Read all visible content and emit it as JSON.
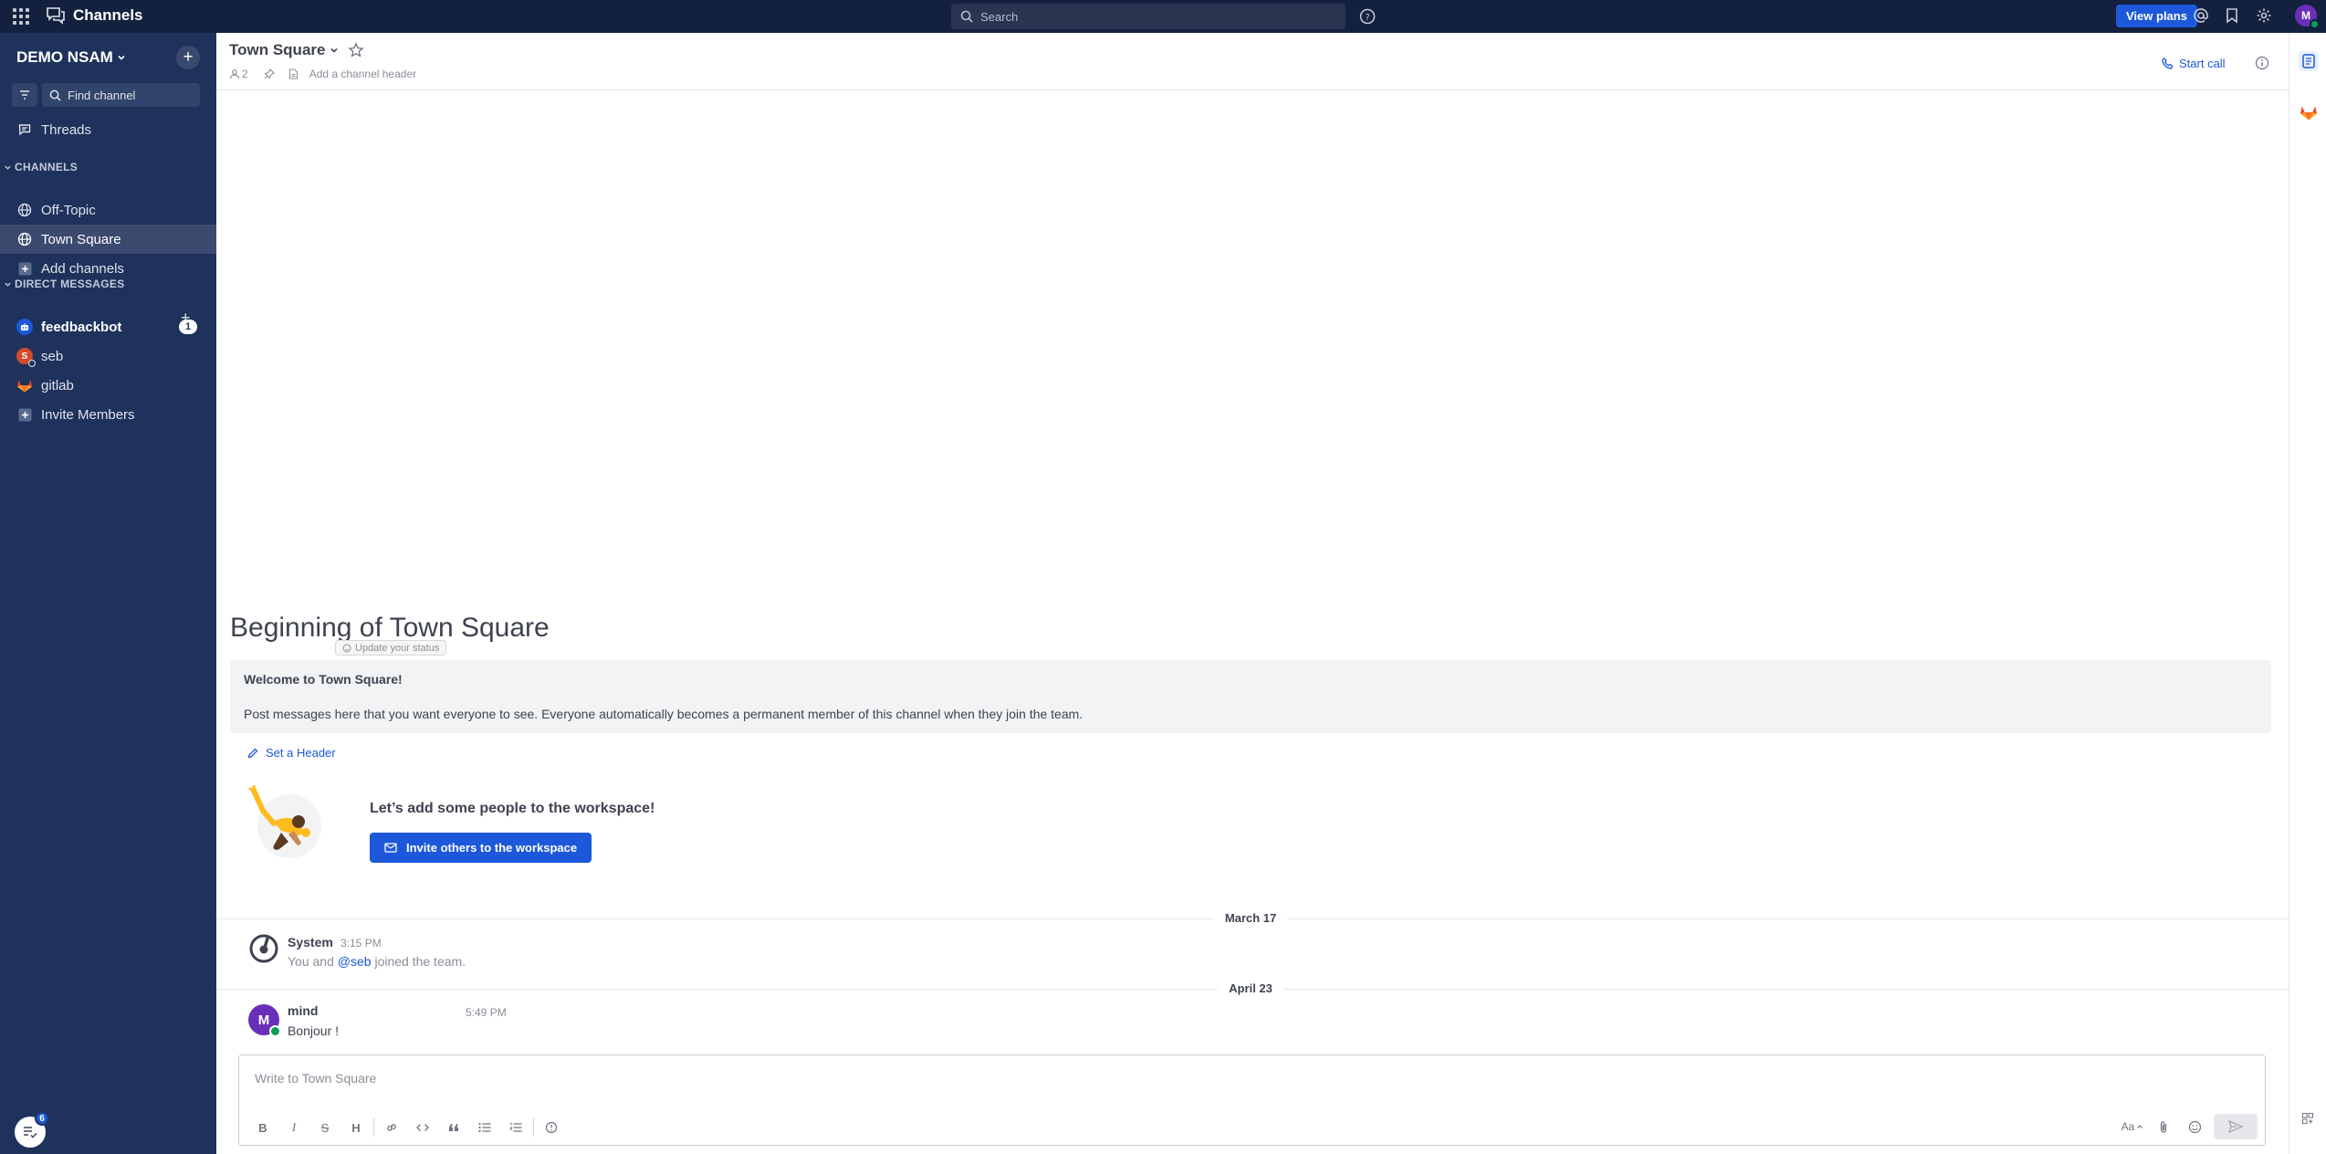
{
  "topbar": {
    "product_name": "Channels",
    "search_placeholder": "Search",
    "view_plans_label": "View plans",
    "avatar_initial": "M"
  },
  "sidebar": {
    "team_name": "DEMO NSAM",
    "find_channel_placeholder": "Find channel",
    "threads_label": "Threads",
    "channels_header": "CHANNELS",
    "channels": [
      {
        "label": "Off-Topic",
        "active": false
      },
      {
        "label": "Town Square",
        "active": true
      }
    ],
    "add_channels_label": "Add channels",
    "dm_header": "DIRECT MESSAGES",
    "dms": [
      {
        "label": "feedbackbot",
        "badge": "1",
        "unread": true
      },
      {
        "label": "seb",
        "avatar_initial": "S"
      },
      {
        "label": "gitlab"
      }
    ],
    "invite_members_label": "Invite Members",
    "bottom_badge": "6"
  },
  "channel": {
    "title": "Town Square",
    "member_count": "2",
    "header_placeholder": "Add a channel header",
    "start_call_label": "Start call"
  },
  "intro": {
    "title": "Beginning of Town Square",
    "welcome_title": "Welcome to Town Square!",
    "welcome_body": "Post messages here that you want everyone to see. Everyone automatically becomes a permanent member of this channel when they join the team.",
    "set_header_label": "Set a Header",
    "invite_title": "Let’s add some people to the workspace!",
    "invite_button": "Invite others to the workspace"
  },
  "posts": {
    "date1": "March 17",
    "system_name": "System",
    "system_time": "3:15 PM",
    "system_text_prefix": "You and",
    "system_mention": "@seb",
    "system_text_suffix": "joined the team.",
    "date2": "April 23",
    "user_name": "mind",
    "user_avatar": "M",
    "status_label": "Update your status",
    "user_time": "5:49 PM",
    "user_text": "Bonjour !"
  },
  "composer": {
    "placeholder": "Write to Town Square",
    "format_buttons": [
      "B",
      "I",
      "S",
      "H"
    ],
    "text_size_label": "Aa"
  },
  "colors": {
    "sidebar_bg": "#1e325c",
    "topbar_bg": "#14213e",
    "accent": "#1c58d9",
    "online": "#06a05a"
  }
}
